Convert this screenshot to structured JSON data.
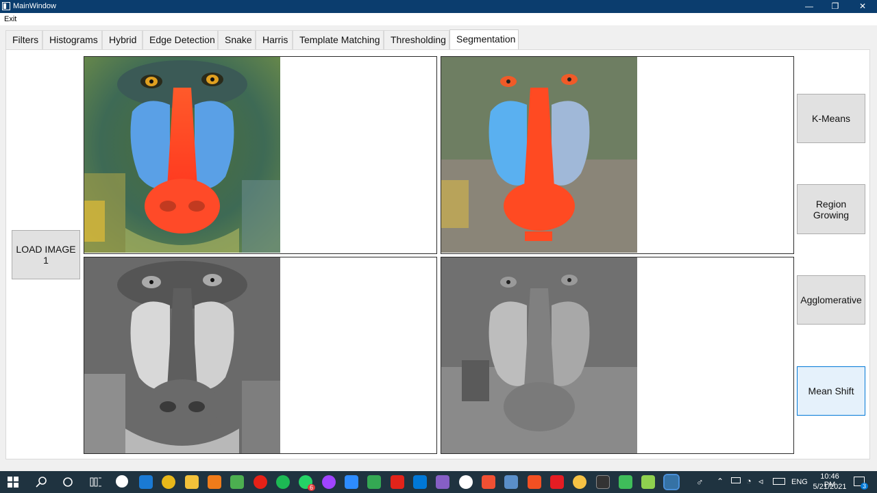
{
  "window": {
    "title": "MainWindow",
    "controls": {
      "minimize": "—",
      "maximize": "❐",
      "close": "✕"
    }
  },
  "menu": {
    "items": [
      "Exit"
    ]
  },
  "tabs": [
    {
      "label": "Filters"
    },
    {
      "label": "Histograms"
    },
    {
      "label": "Hybrid"
    },
    {
      "label": "Edge Detection"
    },
    {
      "label": "Snake"
    },
    {
      "label": "Harris"
    },
    {
      "label": "Template Matching"
    },
    {
      "label": "Thresholding"
    },
    {
      "label": "Segmentation",
      "active": true
    }
  ],
  "main": {
    "load_button": "LOAD IMAGE 1",
    "buttons": [
      "K-Means",
      "Region Growing",
      "Agglomerative",
      "Mean Shift"
    ],
    "active_button": "Mean Shift",
    "views": [
      {
        "content": "mandrill-color-photo"
      },
      {
        "content": "segmented-color-image"
      },
      {
        "content": "mandrill-grayscale-photo"
      },
      {
        "content": "segmented-grayscale-image"
      }
    ]
  },
  "taskbar": {
    "icons": [
      "windows-start-icon",
      "search-icon",
      "cortana-icon",
      "task-view-icon",
      "settings-icon",
      "mail-icon",
      "chrome-icon",
      "file-explorer-icon",
      "vlc-icon",
      "notepad-icon",
      "youtube-icon",
      "spotify-icon",
      "whatsapp-icon",
      "messenger-icon",
      "zoom-icon",
      "drive-icon",
      "acrobat-icon",
      "vscode-icon",
      "visual-studio-icon",
      "app-m-icon",
      "git-icon",
      "bug-icon",
      "office-icon",
      "cube-icon",
      "app-icon",
      "terminal-icon",
      "chat-icon",
      "pen-icon",
      "python-icon"
    ],
    "whatsapp_badge": "6",
    "language": "ENG",
    "time": "10:46 PM",
    "date": "5/21/2021",
    "notification_count": "3",
    "colors": {
      "background": "#1f3340",
      "accent": "#0078d7"
    }
  }
}
